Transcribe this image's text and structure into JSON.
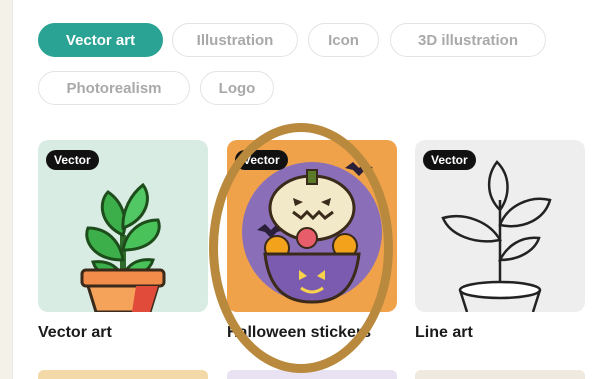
{
  "filters": {
    "chips": [
      {
        "label": "Vector art",
        "active": true
      },
      {
        "label": "Illustration",
        "active": false
      },
      {
        "label": "Icon",
        "active": false
      },
      {
        "label": "3D illustration",
        "active": false
      },
      {
        "label": "Photorealism",
        "active": false
      },
      {
        "label": "Logo",
        "active": false
      }
    ]
  },
  "gallery": {
    "items": [
      {
        "badge": "Vector",
        "caption": "Vector art",
        "icon": "potted-plant-icon",
        "bg": "#d8ece4"
      },
      {
        "badge": "Vector",
        "caption": "Halloween stickers",
        "icon": "pumpkin-sticker-icon",
        "bg": "#f0a24a"
      },
      {
        "badge": "Vector",
        "caption": "Line art",
        "icon": "line-plant-icon",
        "bg": "#eeeeee"
      }
    ]
  },
  "colors": {
    "accent": "#2aa394",
    "annotation": "#b98a3e"
  }
}
